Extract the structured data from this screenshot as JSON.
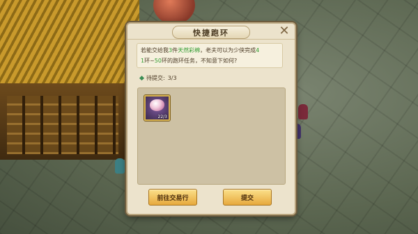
{
  "dialog": {
    "title": "快捷跑环",
    "close_label": "✕",
    "message": {
      "part1": "若能交给我",
      "count": "3",
      "part2": "件",
      "item_name": "天然彩棉",
      "part3": "，老夫可以为少侠完成",
      "rings_from": "4",
      "line2_prefix": "1",
      "part4": "环",
      "tilde": "~",
      "rings_to": "50",
      "part5": "环的跑环任务，不知意下如何?"
    },
    "pending_label": "待提交:",
    "pending_value": "3/3",
    "item_slot": {
      "count": "22/3",
      "icon": "cotton-item-icon"
    },
    "buttons": {
      "trade": "前往交易行",
      "submit": "提交"
    }
  },
  "colors": {
    "highlight_green": "#2d9a2d",
    "button_gold": "#e7a93d"
  }
}
